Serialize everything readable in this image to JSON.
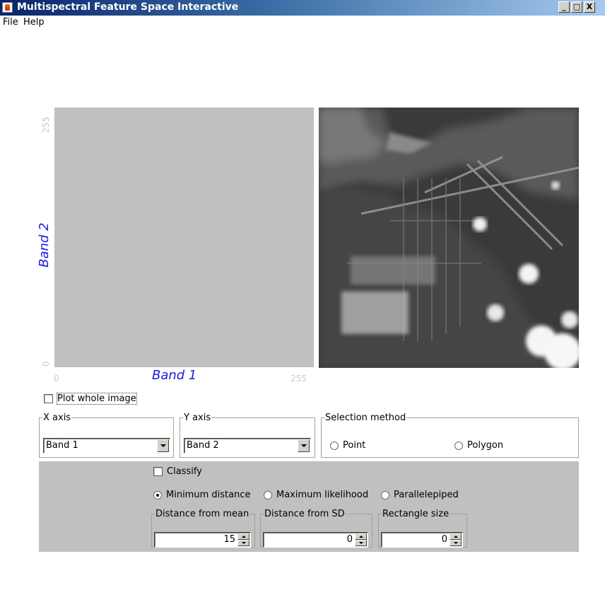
{
  "window": {
    "title": "Multispectral Feature Space Interactive",
    "controls": {
      "minimize": "_",
      "maximize": "□",
      "close": "X"
    }
  },
  "menu": {
    "items": [
      "File",
      "Help"
    ]
  },
  "feature_space": {
    "x_label": "Band 1",
    "y_label": "Band 2",
    "x_ticks": {
      "min": "0",
      "max": "255"
    },
    "y_ticks": {
      "min": "0",
      "max": "255"
    },
    "plot_color": "#c0c0c0",
    "label_color": "#1a1ae6"
  },
  "plot_whole_image": {
    "label": "Plot whole image",
    "checked": false
  },
  "x_axis": {
    "legend": "X axis",
    "selected": "Band 1"
  },
  "y_axis": {
    "legend": "Y axis",
    "selected": "Band 2"
  },
  "selection_method": {
    "legend": "Selection method",
    "options": [
      {
        "label": "Point",
        "selected": false
      },
      {
        "label": "Polygon",
        "selected": false
      }
    ]
  },
  "classify": {
    "label": "Classify",
    "checked": false,
    "methods": [
      {
        "label": "Minimum distance",
        "selected": true
      },
      {
        "label": "Maximum likelihood",
        "selected": false
      },
      {
        "label": "Parallelepiped",
        "selected": false
      }
    ],
    "params": [
      {
        "legend": "Distance from mean",
        "value": "15"
      },
      {
        "legend": "Distance from SD",
        "value": "0"
      },
      {
        "legend": "Rectangle size",
        "value": "0"
      }
    ]
  }
}
